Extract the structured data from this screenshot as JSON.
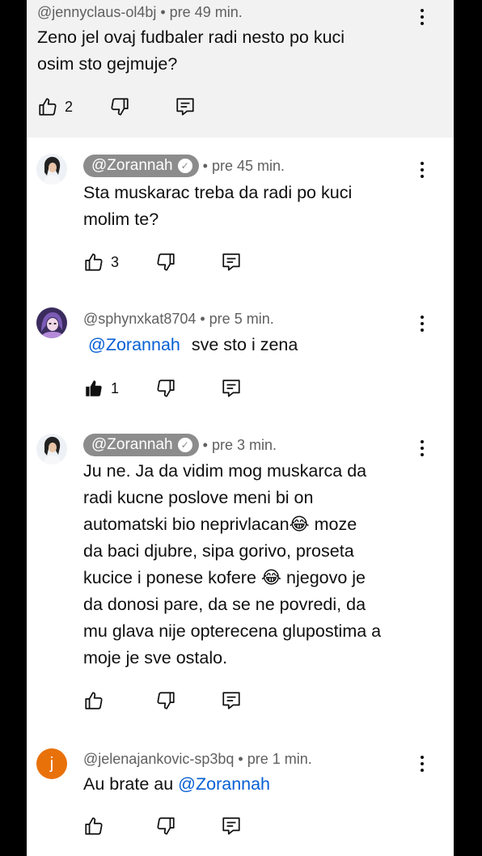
{
  "comments": [
    {
      "author": "@jennyclaus-ol4bj",
      "time": "pre 49 min.",
      "lines": [
        "Zeno jel ovaj fudbaler radi nesto po kuci",
        "osim sto gejmuje?"
      ],
      "likes": "2"
    },
    {
      "author": "@Zorannah",
      "verified_icon": "check-badge-icon",
      "time": "pre 45 min.",
      "lines": [
        "Sta muskarac treba da radi po kuci",
        "molim te?"
      ],
      "likes": "3"
    },
    {
      "author": "@sphynxkat8704",
      "time": "pre 5 min.",
      "mention": "@Zorannah",
      "text": "sve sto i zena",
      "likes": "1",
      "liked": true
    },
    {
      "author": "@Zorannah",
      "verified_icon": "check-badge-icon",
      "time": "pre 3 min.",
      "lines": [
        "Ju ne. Ja da vidim mog muskarca da",
        "radi kucne poslove meni bi on",
        "automatski bio neprivlacan😂 moze",
        "da baci djubre, sipa gorivo, proseta",
        "kucice i ponese kofere 😂 njegovo je",
        "da donosi pare, da se ne povredi, da",
        "mu glava nije opterecena glupostima a",
        "moje je sve ostalo."
      ]
    },
    {
      "author": "@jelenajankovic-sp3bq",
      "avatar_letter": "j",
      "time": "pre 1 min.",
      "text": "Au brate au",
      "mention": "@Zorannah"
    }
  ],
  "colors": {
    "mention": "#065fd4",
    "avatar_orange": "#e8710a",
    "chip_gray": "#8c8c8c"
  },
  "icons": [
    "thumbs-up-icon",
    "thumbs-down-icon",
    "reply-icon",
    "more-vert-icon"
  ]
}
